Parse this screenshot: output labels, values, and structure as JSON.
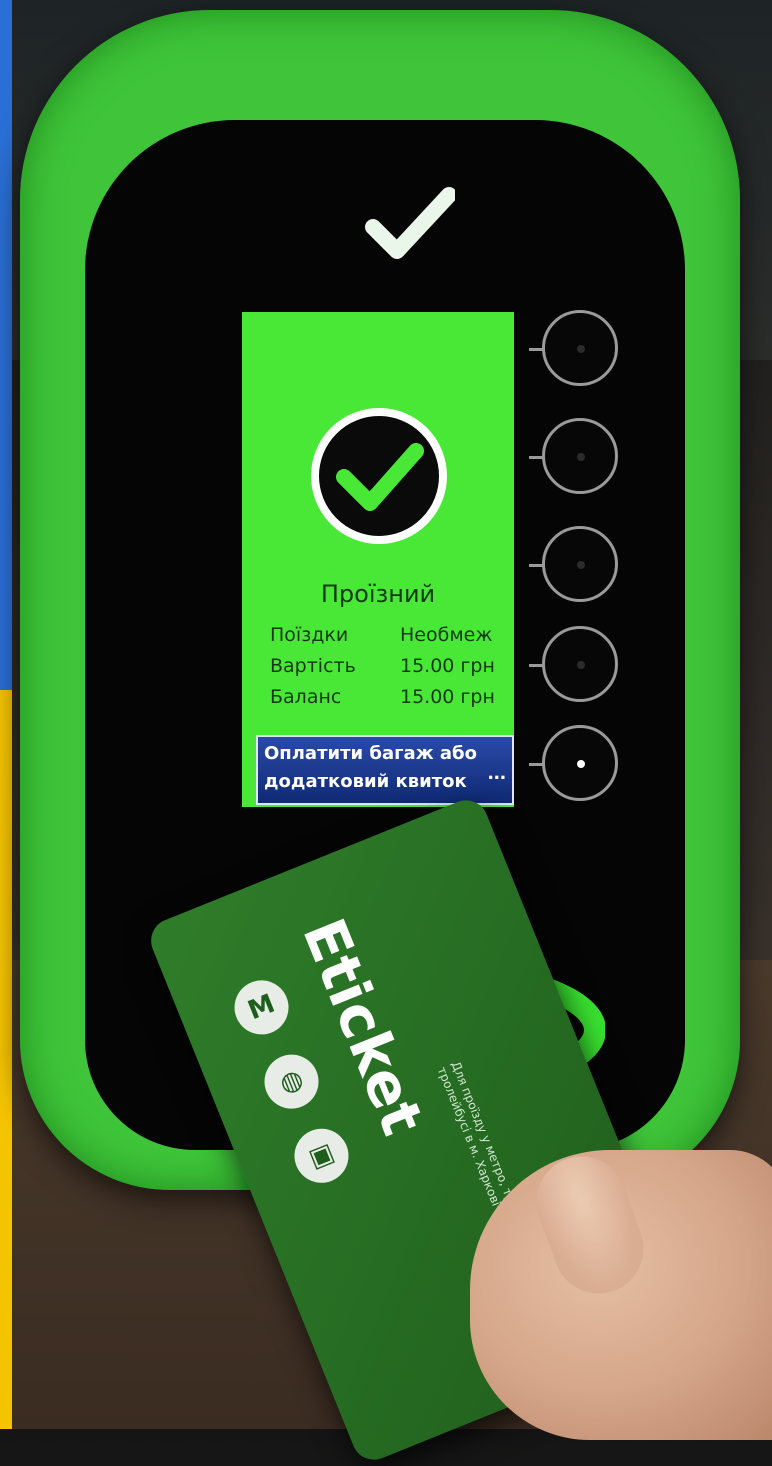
{
  "screen": {
    "status_title": "Проїзний",
    "rows": [
      {
        "label": "Поїздки",
        "value": "Необмеж"
      },
      {
        "label": "Вартість",
        "value": "15.00 грн"
      },
      {
        "label": "Баланс",
        "value": "15.00 грн"
      }
    ],
    "extra_ticket_button": {
      "line1": "Оплатити багаж або",
      "line2": "додатковий квиток",
      "more": "..."
    }
  },
  "card": {
    "brand": "Eticket",
    "description": "Для проїзду у метро, трамваї, тролейбусі в м. Харкові",
    "icons": [
      "metro-icon",
      "tram-icon",
      "trolleybus-icon"
    ]
  },
  "colors": {
    "housing": "#3fc43a",
    "screen_ok": "#49e836",
    "button_blue": "#1a3a8f",
    "flag_blue": "#2a6fd6",
    "flag_yellow": "#f5c400"
  }
}
